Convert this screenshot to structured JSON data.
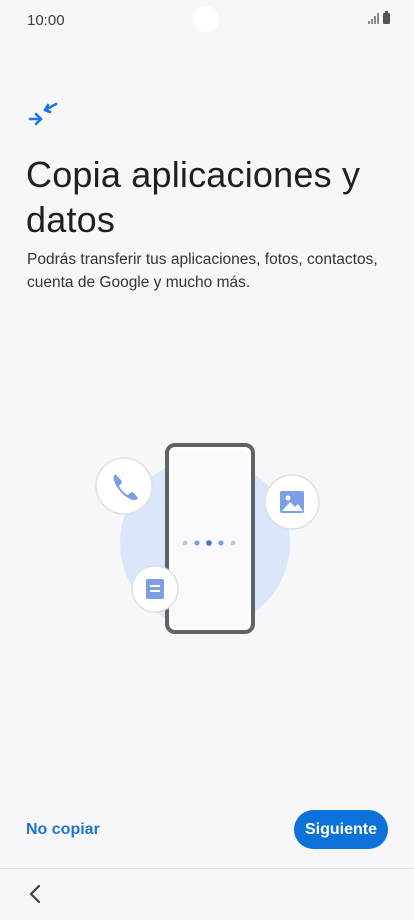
{
  "status_bar": {
    "time": "10:00"
  },
  "header": {
    "icon": "transfer-arrows-icon",
    "title": "Copia aplicaciones y datos",
    "description": "Podrás transferir tus aplicaciones, fotos, contactos, cuenta de Google y mucho más."
  },
  "illustration": {
    "icons": [
      "phone-icon",
      "image-icon",
      "document-icon"
    ],
    "progress_dots": 5
  },
  "footer": {
    "skip_label": "No copiar",
    "next_label": "Siguiente"
  },
  "navigation": {
    "back_icon": "chevron-left-icon"
  },
  "colors": {
    "accent": "#0c72da",
    "link": "#1976d2",
    "background": "#f7f7f9",
    "illustration_circle": "#dbe6fb"
  }
}
